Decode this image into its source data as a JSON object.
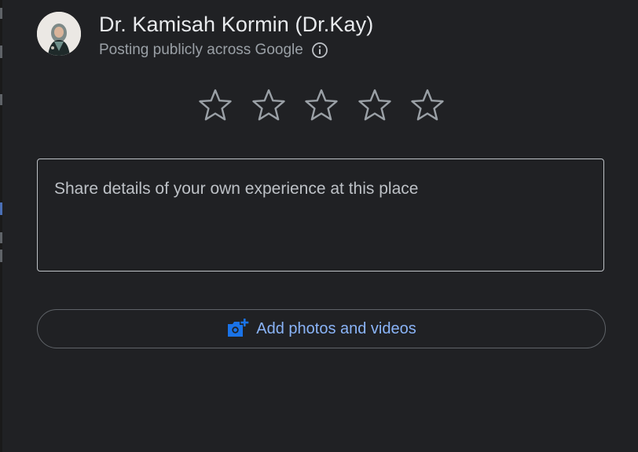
{
  "user": {
    "name": "Dr. Kamisah Kormin (Dr.Kay)",
    "visibility_text": "Posting publicly across Google"
  },
  "rating": {
    "max_stars": 5,
    "selected": 0
  },
  "review": {
    "placeholder": "Share details of your own experience at this place",
    "value": ""
  },
  "media": {
    "add_label": "Add photos and videos"
  },
  "colors": {
    "background": "#202124",
    "primary_text": "#e8eaed",
    "secondary_text": "#9aa0a6",
    "star_outline": "#9aa0a6",
    "accent": "#8ab4f8",
    "camera_icon": "#1a73e8"
  },
  "icons": {
    "info": "info-icon",
    "star": "star-outline-icon",
    "camera": "add-photo-camera-icon"
  }
}
